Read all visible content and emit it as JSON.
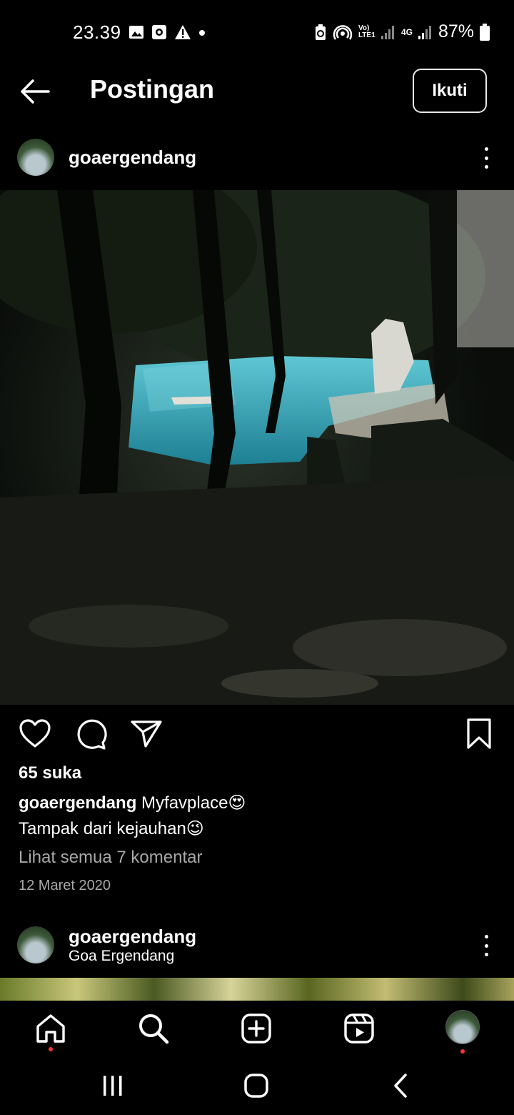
{
  "status_bar": {
    "time": "23.39",
    "network_label": "Vo) LTE1",
    "network_4g": "4G",
    "battery": "87%"
  },
  "header": {
    "title": "Postingan",
    "follow_label": "Ikuti"
  },
  "post": {
    "username": "goaergendang",
    "likes": "65 suka",
    "caption_user": "goaergendang",
    "caption_line1": "Myfavplace😍",
    "caption_line2": "Tampak dari kejauhan😉",
    "view_comments": "Lihat semua 7 komentar",
    "date": "12 Maret 2020"
  },
  "next_post": {
    "username": "goaergendang",
    "location": "Goa Ergendang"
  },
  "bottom_nav": [
    "home-icon",
    "search-icon",
    "create-icon",
    "reels-icon",
    "profile-avatar"
  ],
  "colors": {
    "background": "#000000",
    "muted_text": "#a8a8a8",
    "notification_dot": "#ff3040",
    "pool_water": "#2fa3b4"
  }
}
